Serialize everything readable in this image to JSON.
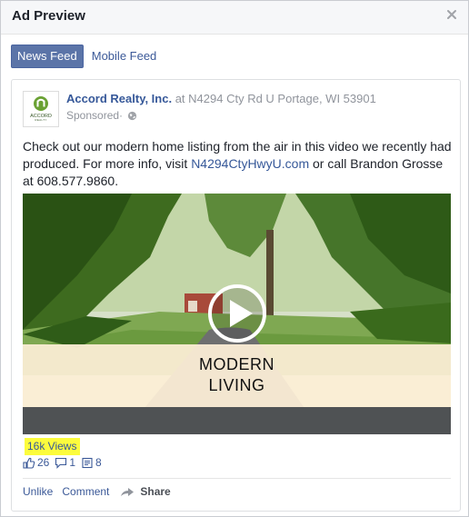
{
  "dialog": {
    "title": "Ad Preview",
    "close_icon": "close-icon"
  },
  "tabs": [
    {
      "label": "News Feed",
      "active": true
    },
    {
      "label": "Mobile Feed",
      "active": false
    }
  ],
  "post": {
    "page_name": "Accord Realty, Inc.",
    "location_prefix": " at ",
    "location": "N4294 Cty Rd U Portage, WI 53901",
    "sponsored": "Sponsored",
    "sponsored_sep": " · ",
    "text_before_link": "Check out our modern home listing from the air in this video we recently had produced. For more info, visit ",
    "link_text": "N4294CtyHwyU.com",
    "text_after_link": " or call Brandon Grosse at 608.577.9860.",
    "logo_text": "ACCORD",
    "logo_subtext": "REALTY",
    "brand_green": "#6aa133",
    "link_color": "#365899"
  },
  "video": {
    "banner_line1": "MODERN",
    "banner_line2": "LIVING",
    "play_icon": "play-icon"
  },
  "views": {
    "label": "16k Views",
    "highlight_color": "#fcfc3d"
  },
  "stats": {
    "likes": "26",
    "comments": "1",
    "shares": "8"
  },
  "actions": {
    "unlike": "Unlike",
    "comment": "Comment",
    "share": "Share"
  }
}
